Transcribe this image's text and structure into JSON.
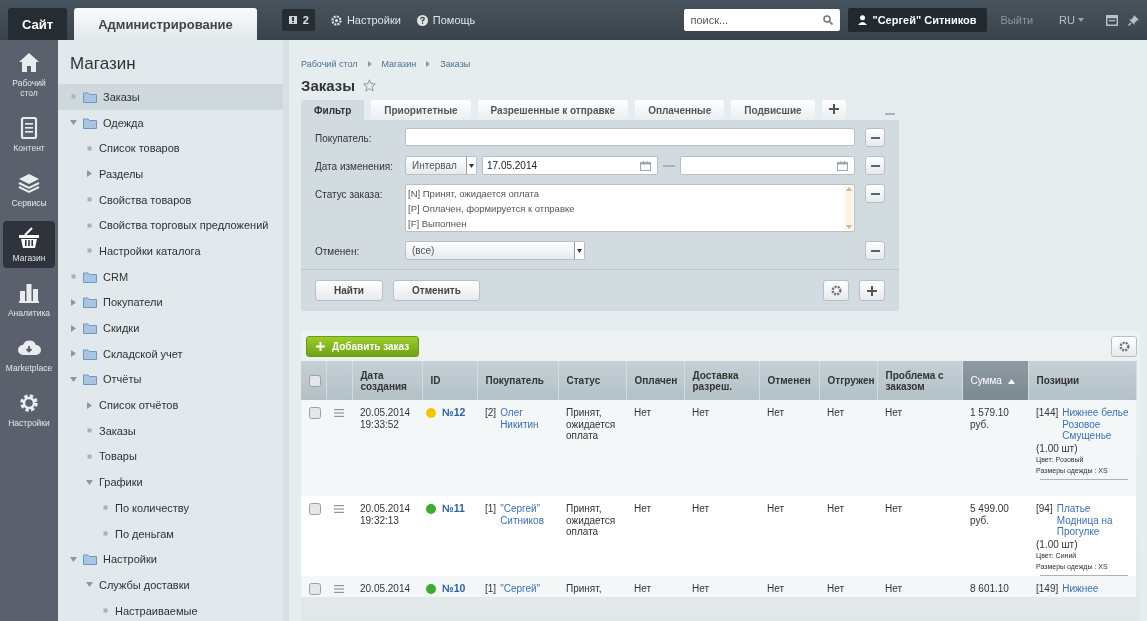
{
  "topbar": {
    "site_tab": {
      "label": "Сайт",
      "selected": false
    },
    "admin_tab": {
      "label": "Администрирование",
      "selected": true
    },
    "notifications": {
      "count": "2"
    },
    "links": [
      "Настройки",
      "Помощь"
    ],
    "search": {
      "placeholder": "поиск..."
    },
    "user": "\"Сергей\" Ситников",
    "logout": "Выйти",
    "language": "RU"
  },
  "rail": [
    {
      "label": "Рабочий стол",
      "selected": false
    },
    {
      "label": "Контент",
      "selected": false
    },
    {
      "label": "Сервисы",
      "selected": false
    },
    {
      "label": "Магазин",
      "selected": true
    },
    {
      "label": "Аналитика",
      "selected": false
    },
    {
      "label": "Marketplace",
      "selected": false
    },
    {
      "label": "Настройки",
      "selected": false
    }
  ],
  "menu": {
    "title": "Магазин",
    "items": [
      {
        "label": "Заказы",
        "kind": "leaf",
        "selected": true
      },
      {
        "label": "Одежда",
        "kind": "branch",
        "expanded": true,
        "selected": false,
        "children": [
          {
            "label": "Список товаров",
            "kind": "leaf",
            "selected": false
          },
          {
            "label": "Разделы",
            "kind": "branch",
            "expanded": false,
            "selected": false
          },
          {
            "label": "Свойства товаров",
            "kind": "leaf",
            "selected": false
          },
          {
            "label": "Свойства торговых предложений",
            "kind": "leaf",
            "selected": false
          },
          {
            "label": "Настройки каталога",
            "kind": "leaf",
            "selected": false
          }
        ]
      },
      {
        "label": "CRM",
        "kind": "leaf",
        "selected": false
      },
      {
        "label": "Покупатели",
        "kind": "branch",
        "expanded": false,
        "selected": false
      },
      {
        "label": "Скидки",
        "kind": "branch",
        "expanded": false,
        "selected": false
      },
      {
        "label": "Складской учет",
        "kind": "branch",
        "expanded": false,
        "selected": false
      },
      {
        "label": "Отчёты",
        "kind": "branch",
        "expanded": true,
        "selected": false,
        "children": [
          {
            "label": "Список отчётов",
            "kind": "branch",
            "expanded": false,
            "selected": false
          },
          {
            "label": "Заказы",
            "kind": "leaf",
            "selected": false
          },
          {
            "label": "Товары",
            "kind": "leaf",
            "selected": false
          },
          {
            "label": "Графики",
            "kind": "branch",
            "expanded": true,
            "selected": false,
            "children": [
              {
                "label": "По количеству",
                "kind": "leaf",
                "selected": false
              },
              {
                "label": "По деньгам",
                "kind": "leaf",
                "selected": false
              }
            ]
          }
        ]
      },
      {
        "label": "Настройки",
        "kind": "branch",
        "expanded": true,
        "selected": false,
        "children": [
          {
            "label": "Службы доставки",
            "kind": "branch",
            "expanded": true,
            "selected": false,
            "children": [
              {
                "label": "Настраиваемые",
                "kind": "leaf",
                "selected": false
              }
            ]
          }
        ]
      }
    ]
  },
  "breadcrumbs": [
    "Рабочий стол",
    "Магазин",
    "Заказы"
  ],
  "page_title": "Заказы",
  "filter": {
    "tabs": [
      {
        "label": "Фильтр",
        "selected": true
      },
      {
        "label": "Приоритетные",
        "selected": false
      },
      {
        "label": "Разрешенные к отправке",
        "selected": false
      },
      {
        "label": "Оплаченные",
        "selected": false
      },
      {
        "label": "Подвисшие",
        "selected": false
      }
    ],
    "fields": [
      {
        "kind": "text",
        "label": "Покупатель:"
      },
      {
        "kind": "interval",
        "label": "Дата изменения:",
        "mode": "Интервал",
        "from": "17.05.2014"
      },
      {
        "kind": "multiselect",
        "label": "Статус заказа:",
        "options": [
          "[N] Принят, ожидается оплата",
          "[P] Оплачен, формируется к отправке",
          "[F] Выполнен"
        ]
      },
      {
        "kind": "select",
        "label": "Отменен:",
        "value": "(все)"
      }
    ],
    "buttons": [
      "Найти",
      "Отменить"
    ]
  },
  "add_button": "Добавить заказ",
  "table": {
    "all_checked": false,
    "columns": [
      {
        "label": "Дата создания",
        "sorted": false
      },
      {
        "label": "ID",
        "sorted": false
      },
      {
        "label": "Покупатель",
        "sorted": false
      },
      {
        "label": "Статус",
        "sorted": false
      },
      {
        "label": "Оплачен",
        "sorted": false
      },
      {
        "label": "Доставка разреш.",
        "sorted": false
      },
      {
        "label": "Отменен",
        "sorted": false
      },
      {
        "label": "Отгружен",
        "sorted": false
      },
      {
        "label": "Проблема с заказом",
        "sorted": false
      },
      {
        "label": "Сумма",
        "sorted": true
      },
      {
        "label": "Позиции",
        "sorted": false
      }
    ],
    "rows": [
      {
        "checked": false,
        "date": "20.05.2014",
        "time": "19:33:52",
        "color": "#f5c400",
        "id": "№12",
        "buyer_code": "[2]",
        "buyer_name": "Олег Никитин",
        "status": "Принят, ожидается оплата",
        "paid": "Нет",
        "delivery": "Нет",
        "canceled": "Нет",
        "shipped": "Нет",
        "problem": "Нет",
        "sum": "1 579.10 руб.",
        "item_code": "[144]",
        "item_name": "Нижнее белье Розовое Смущенье",
        "item_qty": "(1.00 шт)",
        "item_props": [
          "Цвет: Розовый",
          "Размеры одежды : XS"
        ]
      },
      {
        "checked": false,
        "date": "20.05.2014",
        "time": "19:32:13",
        "color": "#3bae2a",
        "id": "№11",
        "buyer_code": "[1]",
        "buyer_name": "\"Сергей\" Ситников",
        "status": "Принят, ожидается оплата",
        "paid": "Нет",
        "delivery": "Нет",
        "canceled": "Нет",
        "shipped": "Нет",
        "problem": "Нет",
        "sum": "5 499.00 руб.",
        "item_code": "[94]",
        "item_name": "Платье Модница на Прогулке",
        "item_qty": "(1.00 шт)",
        "item_props": [
          "Цвет: Синий",
          "Размеры одежды : XS"
        ]
      },
      {
        "checked": false,
        "date": "20.05.2014",
        "color": "#3bae2a",
        "id": "№10",
        "buyer_code": "[1]",
        "buyer_name": "\"Сергей\"",
        "status": "Принят,",
        "paid": "Нет",
        "delivery": "Нет",
        "canceled": "Нет",
        "shipped": "Нет",
        "problem": "Нет",
        "sum": "8 601.10",
        "item_code": "[149]",
        "item_name": "Нижнее"
      }
    ]
  }
}
